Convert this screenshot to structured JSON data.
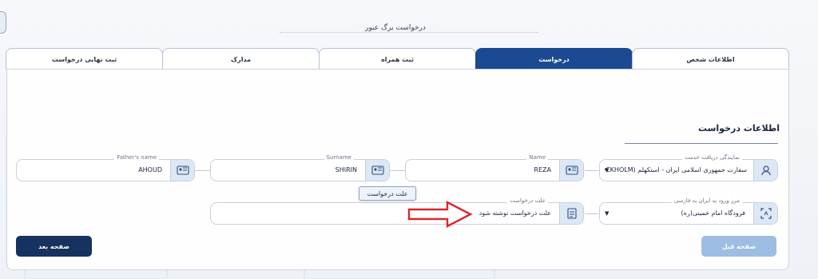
{
  "page_title": "درخواست برگ عبور",
  "tabs": [
    {
      "label": "اطلاعات شخص",
      "active": false
    },
    {
      "label": "درخواست",
      "active": true
    },
    {
      "label": "ثبت همراه",
      "active": false
    },
    {
      "label": "مدارک",
      "active": false
    },
    {
      "label": "ثبت نهایی درخواست",
      "active": false
    }
  ],
  "section": {
    "title": "اطلاعات درخواست"
  },
  "fields": {
    "service_office": {
      "label": "نمایندگی دریافت خدمت",
      "value": "سفارت جمهوری اسلامی ایران - استکهلم (STOCKHOLM"
    },
    "name": {
      "label": "Name",
      "value": "REZA"
    },
    "surname": {
      "label": "Surname",
      "value": "SHIRIN"
    },
    "fathers_name": {
      "label": "Father's name",
      "value": "AHOUD"
    },
    "entry_border": {
      "label": "مرز ورود به ایران به فارسی",
      "value": "فرودگاه امام خمینی(ره)"
    },
    "request_reason": {
      "label": "علت درخواست",
      "value": "علت درخواست نوشته شود"
    }
  },
  "tooltip": {
    "text": "علت درخواست"
  },
  "buttons": {
    "next": "صفحه بعد",
    "prev": "صفحه قبل"
  },
  "colors": {
    "primary": "#1b4a92",
    "next_button": "#16325f",
    "prev_button": "#9ebde3",
    "arrow": "#d9272e"
  }
}
